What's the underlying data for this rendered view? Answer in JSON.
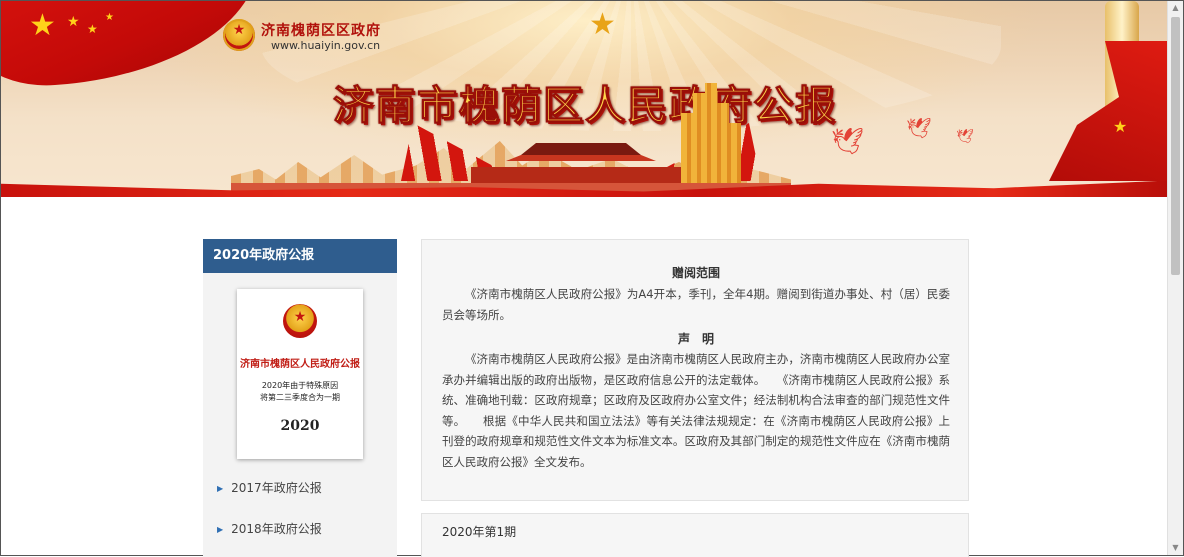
{
  "header": {
    "site_name": "济南槐荫区区政府",
    "site_url": "www.huaiyin.gov.cn",
    "main_title": "济南市槐荫区人民政府公报"
  },
  "sidebar": {
    "title": "2020年政府公报",
    "cover": {
      "title": "济南市槐荫区人民政府公报",
      "note_line1": "2020年由于特殊原因",
      "note_line2": "将第二三季度合为一期",
      "year": "2020"
    },
    "items": [
      {
        "label": "2017年政府公报"
      },
      {
        "label": "2018年政府公报"
      }
    ]
  },
  "main": {
    "section1_title": "赠阅范围",
    "section1_body": "《济南市槐荫区人民政府公报》为A4开本，季刊，全年4期。赠阅到街道办事处、村（居）民委员会等场所。",
    "section2_title": "声　明",
    "section2_body": "《济南市槐荫区人民政府公报》是由济南市槐荫区人民政府主办，济南市槐荫区人民政府办公室承办并编辑出版的政府出版物，是区政府信息公开的法定载体。　　《济南市槐荫区人民政府公报》系统、准确地刊载：区政府规章；区政府及区政府办公室文件；经法制机构合法审查的部门规范性文件等。　　根据《中华人民共和国立法法》等有关法律法规规定：在《济南市槐荫区人民政府公报》上刊登的政府规章和规范性文件文本为标准文本。区政府及其部门制定的规范性文件应在《济南市槐荫区人民政府公报》全文发布。",
    "issue_label": "2020年第1期"
  },
  "colors": {
    "sidebar_header": "#2f5d8e",
    "brand_red": "#c4160f",
    "title_gold": "#ffd64a",
    "link_arrow": "#2f6fb3"
  }
}
